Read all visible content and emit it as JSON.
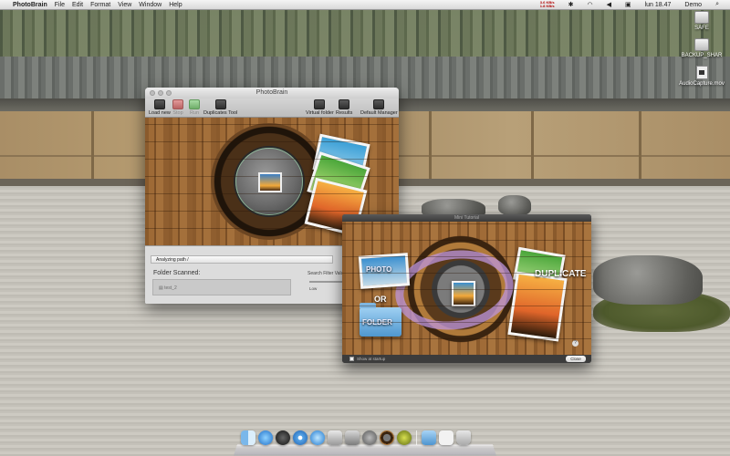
{
  "menubar": {
    "app_name": "PhotoBrain",
    "menus": [
      "File",
      "Edit",
      "Format",
      "View",
      "Window",
      "Help"
    ],
    "net_up": "3.6 KB/s",
    "net_down": "1.8 KB/s",
    "clock": "lun 18.47",
    "user": "Demo"
  },
  "desktop_icons": [
    {
      "label": "SAFE",
      "icon": "drive-icon"
    },
    {
      "label": "BACKUP_SHAR",
      "icon": "drive-icon"
    },
    {
      "label": "AudioCapture.mov",
      "icon": "movie-file-icon"
    }
  ],
  "main_window": {
    "title": "PhotoBrain",
    "toolbar": {
      "load_new": "Load new",
      "stop": "Stop",
      "run": "Run",
      "duplicates_tool": "Duplicates Tool",
      "virtual_folder": "Virtual folder",
      "results": "Results",
      "default_manager": "Default Manager"
    },
    "analyzing": "Analyzing path /",
    "folder_scanned_label": "Folder Scanned:",
    "scanned_item": "test_2",
    "search_filter_label": "Search Filter Valu",
    "filter_low": "Low"
  },
  "tutorial": {
    "title": "Mini Tutorial",
    "photo_label": "PHOTO",
    "or_label": "OR",
    "folder_label": "FOLDER",
    "duplicate_label": "DUPLICATE",
    "help": "?",
    "show_at_startup": "Show at startup",
    "close": "Close"
  },
  "dock": {
    "apps": [
      "finder-icon",
      "app-store-icon",
      "dashboard-icon",
      "safari-icon",
      "itunes-icon",
      "preview-icon",
      "photo-booth-icon",
      "system-preferences-icon",
      "photobrain-icon",
      "gear-icon",
      "folder-icon",
      "document-icon",
      "trash-icon"
    ]
  },
  "colors": {
    "wood": "#9e6a36",
    "menubar": "#e6e6e6",
    "tutorial_arrow": "#be96dc"
  }
}
